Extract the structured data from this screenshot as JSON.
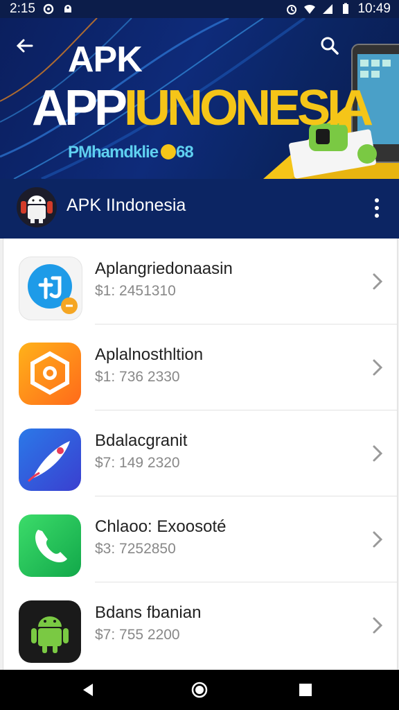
{
  "status_bar": {
    "time_left": "2:15",
    "time_right": "10:49"
  },
  "banner": {
    "line1": "APK",
    "title_white": "APP",
    "title_yellow": "IUNONESIA",
    "subtitle": "PMhamdklie",
    "subtitle_suffix": "68"
  },
  "channel": {
    "name": "APK IIndonesia"
  },
  "apps": [
    {
      "name": "Aplangriedonaasin",
      "price": "$1: 2451310",
      "icon": "blue-app-icon"
    },
    {
      "name": "Aplalnosthltion",
      "price": "$1: 736 2330",
      "icon": "orange-app-icon"
    },
    {
      "name": "Bdalacgranit",
      "price": "$7: 149 2320",
      "icon": "rocket-app-icon"
    },
    {
      "name": "Chlaoo: Exoosoté",
      "price": "$3: 7252850",
      "icon": "phone-app-icon"
    },
    {
      "name": "Bdans fbanian",
      "price": "$7: 755 2200",
      "icon": "android-app-icon"
    }
  ],
  "colors": {
    "banner_blue": "#0e2b7a",
    "accent_yellow": "#f5c518",
    "channel_blue": "#0c2563"
  }
}
